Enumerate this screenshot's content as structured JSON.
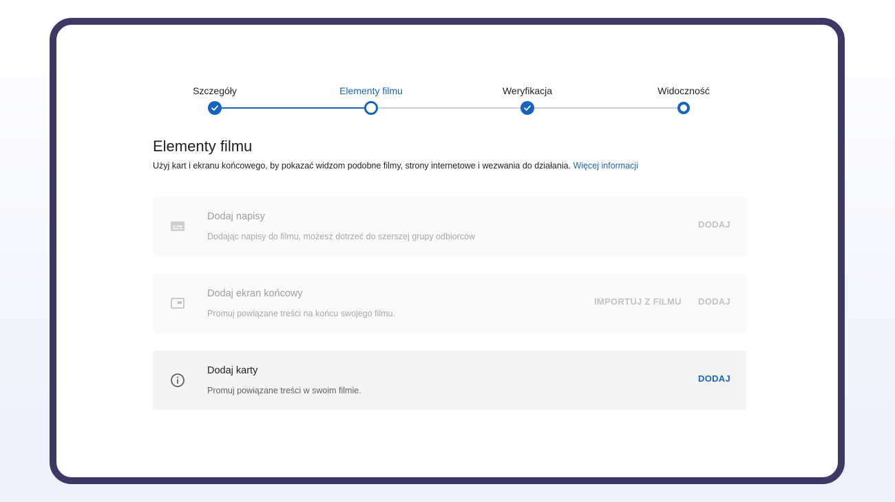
{
  "stepper": {
    "steps": [
      {
        "label": "Szczegóły",
        "state": "done"
      },
      {
        "label": "Elementy filmu",
        "state": "current"
      },
      {
        "label": "Weryfikacja",
        "state": "done"
      },
      {
        "label": "Widoczność",
        "state": "todo"
      }
    ]
  },
  "header": {
    "title": "Elementy filmu",
    "description": "Użyj kart i ekranu końcowego, by pokazać widzom podobne filmy, strony internetowe i wezwania do działania.",
    "link": "Więcej informacji"
  },
  "cards": [
    {
      "icon": "subtitles-icon",
      "title": "Dodaj napisy",
      "description": "Dodając napisy do filmu, możesz dotrzeć do szerszej grupy odbiorców",
      "add_label": "DODAJ",
      "enabled": false
    },
    {
      "icon": "end-screen-icon",
      "title": "Dodaj ekran końcowy",
      "description": "Promuj powiązane treści na końcu swojego filmu.",
      "import_label": "IMPORTUJ Z FILMU",
      "add_label": "DODAJ",
      "enabled": false
    },
    {
      "icon": "info-icon",
      "title": "Dodaj karty",
      "description": "Promuj powiązane treści w swoim filmie.",
      "add_label": "DODAJ",
      "enabled": true
    }
  ],
  "colors": {
    "accent": "#1565c0",
    "frame": "#3d3964",
    "disabled_text": "#c2c2c2"
  }
}
